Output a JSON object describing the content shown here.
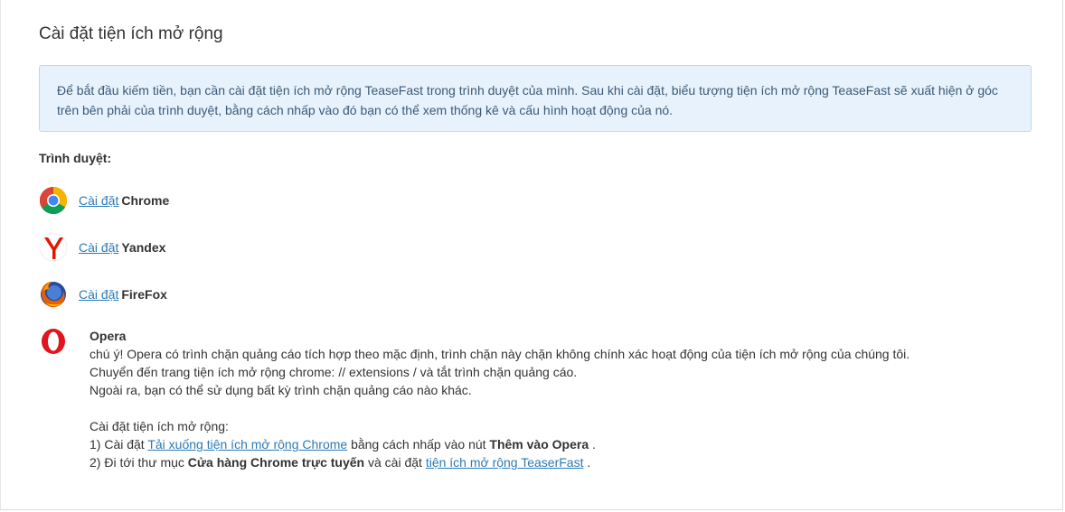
{
  "title": "Cài đặt tiện ích mở rộng",
  "info": "Để bắt đầu kiếm tiền, bạn cần cài đặt tiện ích mở rộng TeaseFast trong trình duyệt của mình. Sau khi cài đặt, biểu tượng tiện ích mở rộng TeaseFast sẽ xuất hiện ở góc trên bên phải của trình duyệt, bằng cách nhấp vào đó bạn có thể xem thống kê và cấu hình hoạt động của nó.",
  "browsers_label": "Trình duyệt:",
  "browsers": [
    {
      "link": "Cài đặt ",
      "name": "Chrome",
      "icon": "chrome-icon"
    },
    {
      "link": "Cài đặt ",
      "name": "Yandex",
      "icon": "yandex-icon"
    },
    {
      "link": "Cài đặt ",
      "name": "FireFox",
      "icon": "firefox-icon"
    }
  ],
  "opera": {
    "icon": "opera-icon",
    "name": "Opera",
    "line1": "chú ý! Opera có trình chặn quảng cáo tích hợp theo mặc định, trình chặn này chặn không chính xác hoạt động của tiện ích mở rộng của chúng tôi.",
    "line2": "Chuyển đến trang tiện ích mở rộng chrome: // extensions / và tắt trình chặn quảng cáo.",
    "line3": "Ngoài ra, bạn có thể sử dụng bất kỳ trình chặn quảng cáo nào khác.",
    "install_heading": "Cài đặt tiện ích mở rộng:",
    "step1_prefix": "1) Cài đặt ",
    "step1_link": "Tải xuống tiện ích mở rộng Chrome",
    "step1_middle": " bằng cách nhấp vào nút ",
    "step1_bold": "Thêm vào Opera",
    "step1_suffix": " .",
    "step2_prefix": "2) Đi tới thư mục ",
    "step2_bold": "Cửa hàng Chrome trực tuyến",
    "step2_middle": " và cài đặt ",
    "step2_link": "tiện ích mở rộng TeaserFast",
    "step2_suffix": " ."
  },
  "colors": {
    "link": "#2a7ab8",
    "info_bg": "#e8f2fc",
    "info_border": "#bcd8ef"
  }
}
